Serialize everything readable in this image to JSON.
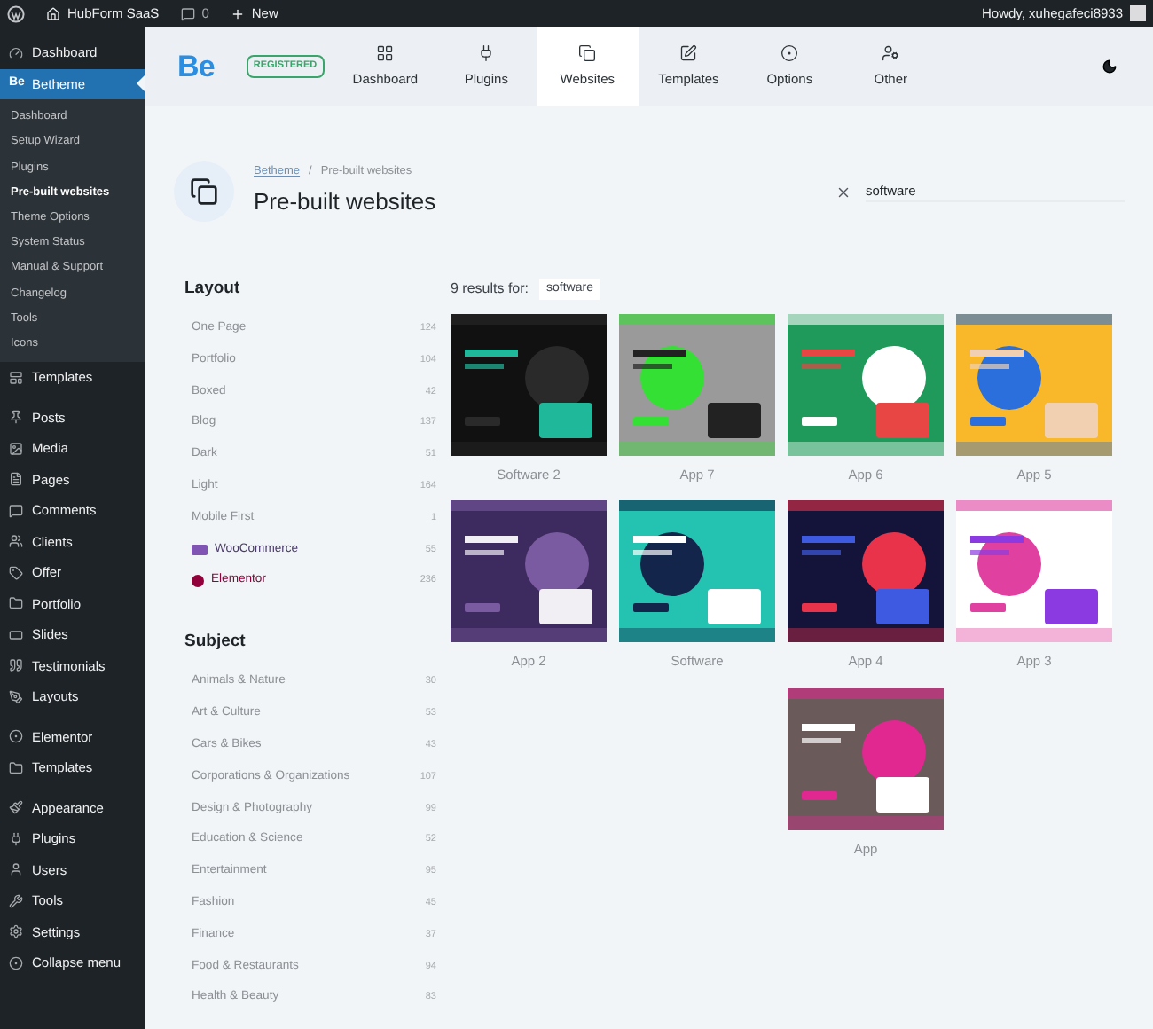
{
  "admin_bar": {
    "site": "HubForm SaaS",
    "comments": "0",
    "new": "New",
    "greeting": "Howdy, xuhegafeci8933"
  },
  "sidebar": {
    "groups": [
      [
        {
          "label": "Dashboard",
          "selected": false
        },
        {
          "label": "Betheme",
          "mark": "Be",
          "selected": true,
          "children": [
            {
              "label": "Dashboard",
              "selected": false
            },
            {
              "label": "Setup Wizard",
              "selected": false
            },
            {
              "label": "Plugins",
              "selected": false
            },
            {
              "label": "Pre-built websites",
              "selected": true
            },
            {
              "label": "Theme Options",
              "selected": false
            },
            {
              "label": "System Status",
              "selected": false
            },
            {
              "label": "Manual & Support",
              "selected": false
            },
            {
              "label": "Changelog",
              "selected": false
            },
            {
              "label": "Tools",
              "selected": false
            },
            {
              "label": "Icons",
              "selected": false
            }
          ]
        },
        {
          "label": "Templates",
          "selected": false
        }
      ],
      [
        {
          "label": "Posts",
          "selected": false
        },
        {
          "label": "Media",
          "selected": false
        },
        {
          "label": "Pages",
          "selected": false
        },
        {
          "label": "Comments",
          "selected": false
        },
        {
          "label": "Clients",
          "selected": false
        },
        {
          "label": "Offer",
          "selected": false
        },
        {
          "label": "Portfolio",
          "selected": false
        },
        {
          "label": "Slides",
          "selected": false
        },
        {
          "label": "Testimonials",
          "selected": false
        },
        {
          "label": "Layouts",
          "selected": false
        }
      ],
      [
        {
          "label": "Elementor",
          "selected": false
        },
        {
          "label": "Templates",
          "selected": false
        }
      ],
      [
        {
          "label": "Appearance",
          "selected": false
        },
        {
          "label": "Plugins",
          "selected": false
        },
        {
          "label": "Users",
          "selected": false
        },
        {
          "label": "Tools",
          "selected": false
        },
        {
          "label": "Settings",
          "selected": false
        },
        {
          "label": "Collapse menu",
          "selected": false
        }
      ]
    ]
  },
  "header": {
    "logo": "Be",
    "badge": "REGISTERED",
    "tabs": [
      {
        "label": "Dashboard",
        "selected": false
      },
      {
        "label": "Plugins",
        "selected": false
      },
      {
        "label": "Websites",
        "selected": true
      },
      {
        "label": "Templates",
        "selected": false
      },
      {
        "label": "Options",
        "selected": false
      },
      {
        "label": "Other",
        "selected": false
      }
    ]
  },
  "page": {
    "breadcrumb": [
      "Betheme",
      "Pre-built websites"
    ],
    "breadcrumb_separator": "/",
    "title": "Pre-built websites",
    "search": {
      "value": "software"
    }
  },
  "filters": [
    {
      "heading": "Layout",
      "items": [
        {
          "label": "One Page",
          "count": "124",
          "kind": "plain"
        },
        {
          "label": "Portfolio",
          "count": "104",
          "kind": "plain"
        },
        {
          "label": "Boxed",
          "count": "42",
          "kind": "plain"
        },
        {
          "label": "Blog",
          "count": "137",
          "kind": "plain"
        },
        {
          "label": "Dark",
          "count": "51",
          "kind": "plain"
        },
        {
          "label": "Light",
          "count": "164",
          "kind": "plain"
        },
        {
          "label": "Mobile First",
          "count": "1",
          "kind": "plain"
        },
        {
          "label": "WooCommerce",
          "count": "55",
          "kind": "woo"
        },
        {
          "label": "Elementor",
          "count": "236",
          "kind": "elementor"
        }
      ]
    },
    {
      "heading": "Subject",
      "items": [
        {
          "label": "Animals & Nature",
          "count": "30",
          "kind": "plain"
        },
        {
          "label": "Art & Culture",
          "count": "53",
          "kind": "plain"
        },
        {
          "label": "Cars & Bikes",
          "count": "43",
          "kind": "plain"
        },
        {
          "label": "Corporations & Organizations",
          "count": "107",
          "kind": "plain"
        },
        {
          "label": "Design & Photography",
          "count": "99",
          "kind": "plain"
        },
        {
          "label": "Education & Science",
          "count": "52",
          "kind": "plain"
        },
        {
          "label": "Entertainment",
          "count": "95",
          "kind": "plain"
        },
        {
          "label": "Fashion",
          "count": "45",
          "kind": "plain"
        },
        {
          "label": "Finance",
          "count": "37",
          "kind": "plain"
        },
        {
          "label": "Food & Restaurants",
          "count": "94",
          "kind": "plain"
        },
        {
          "label": "Health & Beauty",
          "count": "83",
          "kind": "plain"
        }
      ]
    }
  ],
  "results": {
    "summary": "9 results for:",
    "query": "software",
    "items": [
      {
        "name": "Software 2",
        "kind": "picture"
      },
      {
        "name": "App 7",
        "kind": "picture"
      },
      {
        "name": "App 6",
        "kind": "picture"
      },
      {
        "name": "App 5",
        "kind": "picture"
      },
      {
        "name": "App 2",
        "kind": "picture"
      },
      {
        "name": "Software",
        "kind": "picture"
      },
      {
        "name": "App 4",
        "kind": "picture"
      },
      {
        "name": "App 3",
        "kind": "picture"
      },
      {
        "name": "App",
        "kind": "picture"
      }
    ]
  }
}
